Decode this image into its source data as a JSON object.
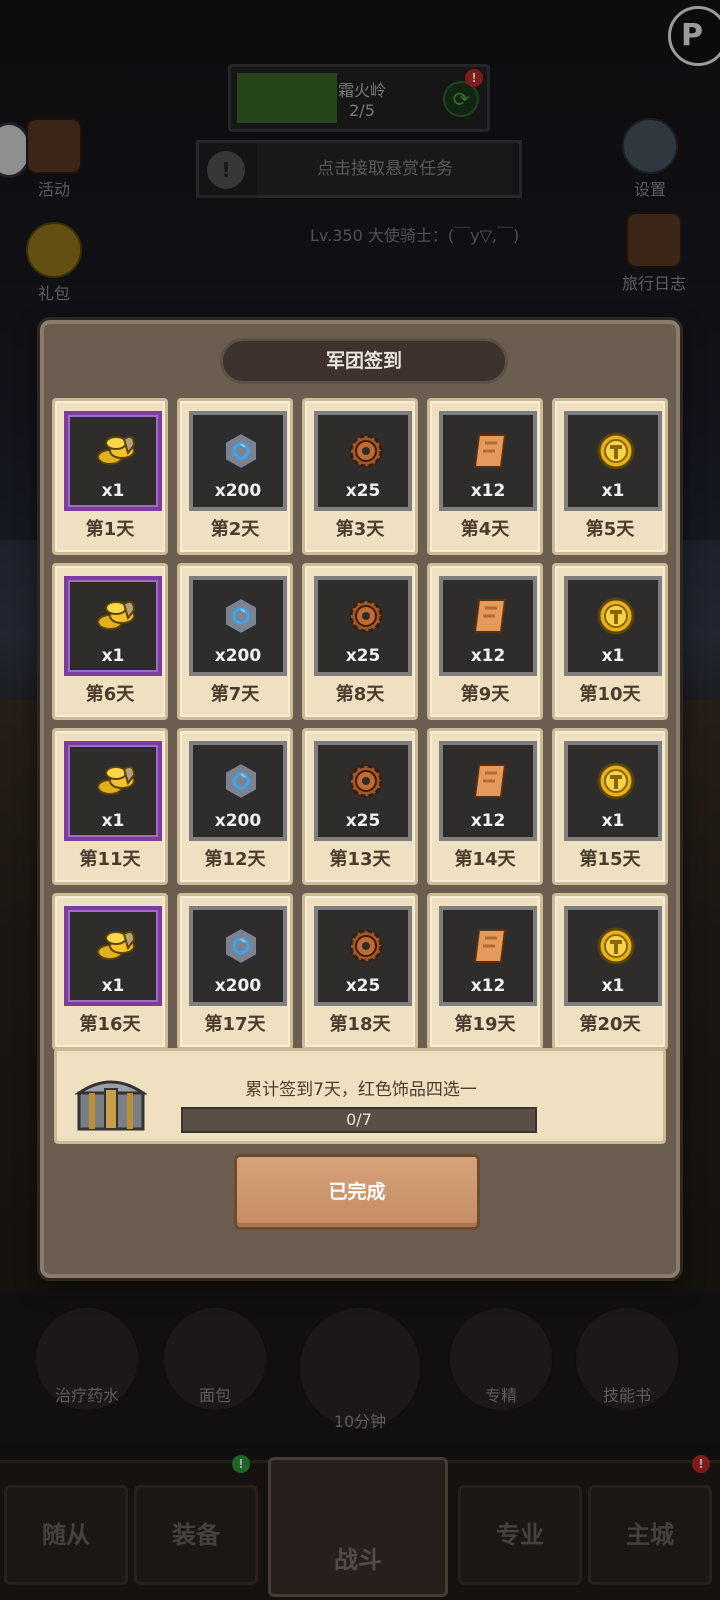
{
  "stage": {
    "title": "霜火岭",
    "progress_text": "2/5",
    "progress": 0.4,
    "badge": "!"
  },
  "quest": {
    "text": "点击接取悬赏任务",
    "icon": "!"
  },
  "level_text": "Lv.350 大使骑士：(￣y▽,￣)",
  "side_buttons": {
    "activity": "活动",
    "gift": "礼包",
    "settings": "设置",
    "travel_log": "旅行日志"
  },
  "corner_button": "P",
  "modal": {
    "title": "军团签到",
    "days": [
      {
        "label": "第1天",
        "qty": "x1",
        "item": "gold-coins-icon",
        "rarity": "purple"
      },
      {
        "label": "第2天",
        "qty": "x200",
        "item": "stone-icon",
        "rarity": "gray"
      },
      {
        "label": "第3天",
        "qty": "x25",
        "item": "gear-icon",
        "rarity": "gray"
      },
      {
        "label": "第4天",
        "qty": "x12",
        "item": "scroll-icon",
        "rarity": "gray"
      },
      {
        "label": "第5天",
        "qty": "x1",
        "item": "medal-icon",
        "rarity": "gray"
      },
      {
        "label": "第6天",
        "qty": "x1",
        "item": "gold-coins-icon",
        "rarity": "purple"
      },
      {
        "label": "第7天",
        "qty": "x200",
        "item": "stone-icon",
        "rarity": "gray"
      },
      {
        "label": "第8天",
        "qty": "x25",
        "item": "gear-icon",
        "rarity": "gray"
      },
      {
        "label": "第9天",
        "qty": "x12",
        "item": "scroll-icon",
        "rarity": "gray"
      },
      {
        "label": "第10天",
        "qty": "x1",
        "item": "medal-icon",
        "rarity": "gray"
      },
      {
        "label": "第11天",
        "qty": "x1",
        "item": "gold-coins-icon",
        "rarity": "purple"
      },
      {
        "label": "第12天",
        "qty": "x200",
        "item": "stone-icon",
        "rarity": "gray"
      },
      {
        "label": "第13天",
        "qty": "x25",
        "item": "gear-icon",
        "rarity": "gray"
      },
      {
        "label": "第14天",
        "qty": "x12",
        "item": "scroll-icon",
        "rarity": "gray"
      },
      {
        "label": "第15天",
        "qty": "x1",
        "item": "medal-icon",
        "rarity": "gray"
      },
      {
        "label": "第16天",
        "qty": "x1",
        "item": "gold-coins-icon",
        "rarity": "purple"
      },
      {
        "label": "第17天",
        "qty": "x200",
        "item": "stone-icon",
        "rarity": "gray"
      },
      {
        "label": "第18天",
        "qty": "x25",
        "item": "gear-icon",
        "rarity": "gray"
      },
      {
        "label": "第19天",
        "qty": "x12",
        "item": "scroll-icon",
        "rarity": "gray"
      },
      {
        "label": "第20天",
        "qty": "x1",
        "item": "medal-icon",
        "rarity": "gray"
      }
    ],
    "cumulative": {
      "text": "累计签到7天，红色饰品四选一",
      "progress_text": "0/7",
      "progress": 0
    },
    "done_button": "已完成"
  },
  "consumables": [
    {
      "label": "治疗药水",
      "icon": "potion-icon"
    },
    {
      "label": "面包",
      "icon": "bread-icon"
    },
    {
      "label": "10分钟",
      "icon": "chest-icon"
    },
    {
      "label": "专精",
      "icon": "mastery-icon"
    },
    {
      "label": "技能书",
      "icon": "skill-book-icon"
    }
  ],
  "nav": {
    "followers": "随从",
    "equipment": "装备",
    "battle": "战斗",
    "profession": "专业",
    "main_city": "主城",
    "badge": "!"
  },
  "colors": {
    "modal_bg": "#6b5e51",
    "card_bg": "#efe0c1",
    "purple_frame": "#7b3ea0",
    "done_button": "#c48d63",
    "stage_fill": "#3c6a2a"
  }
}
